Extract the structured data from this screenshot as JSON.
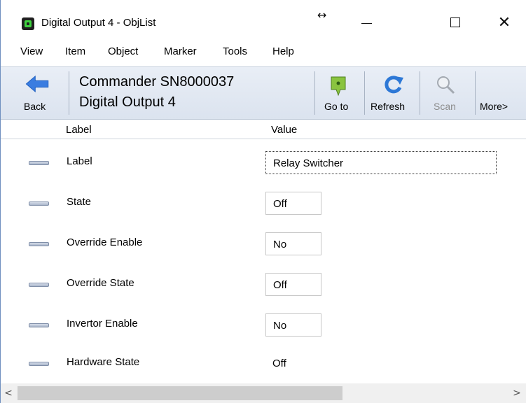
{
  "window": {
    "title": "Digital Output 4 - ObjList",
    "resize_glyph": "↔",
    "close_glyph": "✕"
  },
  "menu": [
    "View",
    "Item",
    "Object",
    "Marker",
    "Tools",
    "Help"
  ],
  "toolbar": {
    "back_label": "Back",
    "device_name": "Commander SN8000037",
    "object_name": "Digital Output 4",
    "goto_label": "Go to",
    "refresh_label": "Refresh",
    "scan_label": "Scan",
    "more_label": "More>",
    "scan_disabled": true
  },
  "columns": {
    "label": "Label",
    "value": "Value"
  },
  "rows": [
    {
      "label": "Label",
      "value": "Relay Switcher",
      "style": "wide"
    },
    {
      "label": "State",
      "value": "Off",
      "style": "boxed"
    },
    {
      "label": "Override Enable",
      "value": "No",
      "style": "boxed"
    },
    {
      "label": "Override State",
      "value": "Off",
      "style": "boxed"
    },
    {
      "label": "Invertor Enable",
      "value": "No",
      "style": "boxed"
    },
    {
      "label": "Hardware State",
      "value": "Off",
      "style": "plain"
    }
  ],
  "scrollbar": {
    "left_glyph": "<",
    "right_glyph": ">"
  },
  "colors": {
    "accent_arrow": "#3b7de0",
    "goto_pin": "#8ac43f",
    "toolbar_bg": "#dfe6f1"
  }
}
